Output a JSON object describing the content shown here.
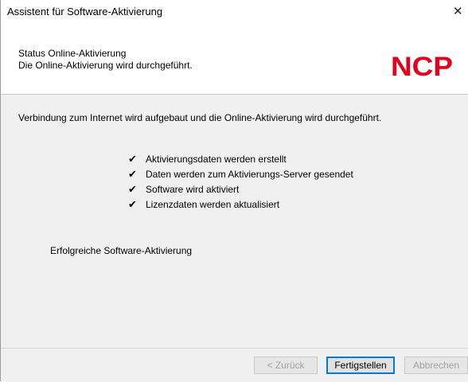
{
  "window": {
    "title": "Assistent für Software-Aktivierung",
    "close_symbol": "✕"
  },
  "header": {
    "title": "Status Online-Aktivierung",
    "subtitle": "Die Online-Aktivierung wird durchgeführt.",
    "logo": {
      "text": "NCP",
      "color": "#e2001a"
    }
  },
  "main": {
    "intro": "Verbindung zum Internet wird aufgebaut und die Online-Aktivierung wird durchgeführt.",
    "check_symbol": "✔",
    "steps": [
      "Aktivierungsdaten werden erstellt",
      "Daten werden zum Aktivierungs-Server gesendet",
      "Software wird aktiviert",
      "Lizenzdaten werden aktualisiert"
    ],
    "result": "Erfolgreiche Software-Aktivierung"
  },
  "footer": {
    "back_label": "< Zurück",
    "finish_label": "Fertigstellen",
    "cancel_label": "Abbrechen"
  },
  "colors": {
    "accent": "#0078d7",
    "brand": "#e2001a",
    "disabled_text": "#a0a0a0"
  }
}
